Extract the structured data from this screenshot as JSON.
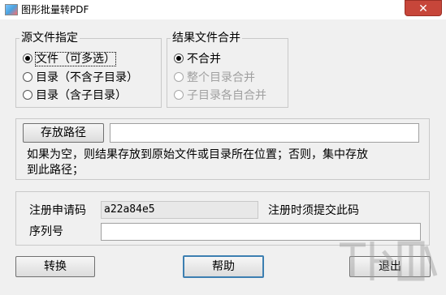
{
  "window": {
    "title": "图形批量转PDF",
    "close_glyph": "✕"
  },
  "source_group": {
    "legend": "源文件指定",
    "options": [
      {
        "label": "文件（可多选）",
        "checked": true
      },
      {
        "label": "目录（不含子目录）",
        "checked": false
      },
      {
        "label": "目录（含子目录）",
        "checked": false
      }
    ]
  },
  "merge_group": {
    "legend": "结果文件合并",
    "options": [
      {
        "label": "不合并",
        "checked": true,
        "enabled": true
      },
      {
        "label": "整个目录合并",
        "checked": false,
        "enabled": false
      },
      {
        "label": "子目录各自合并",
        "checked": false,
        "enabled": false
      }
    ]
  },
  "output": {
    "button_label": "存放路径",
    "path_value": "",
    "hint_line1": "如果为空，则结果存放到原始文件或目录所在位置；否则，集中存放",
    "hint_line2": "到此路径；"
  },
  "registration": {
    "code_label": "注册申请码",
    "code_value": "a22a84e5",
    "code_note": "注册时须提交此码",
    "serial_label": "序列号",
    "serial_value": ""
  },
  "buttons": {
    "convert": "转换",
    "help": "帮助",
    "exit": "退出"
  },
  "icons": {
    "app": "app-icon",
    "close": "close-icon"
  }
}
